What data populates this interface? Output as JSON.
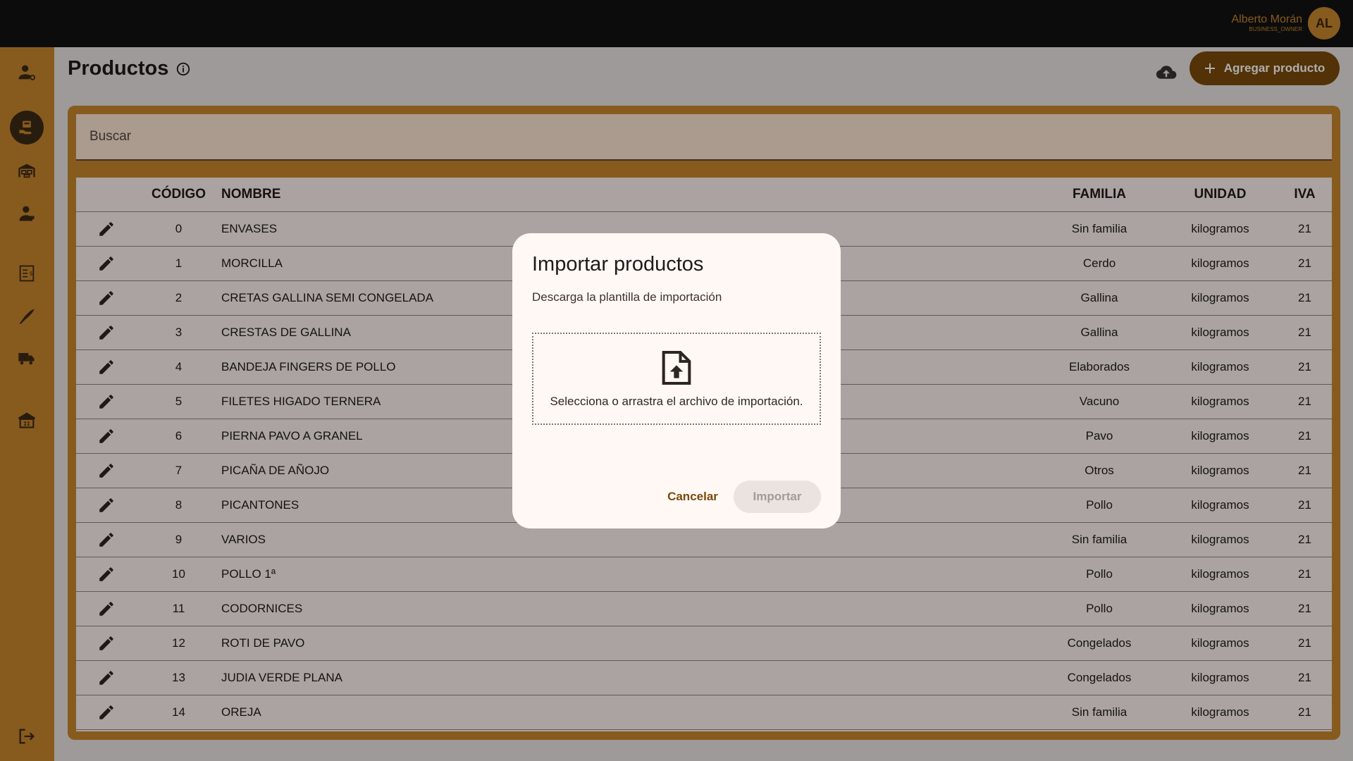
{
  "user": {
    "name": "Alberto Morán",
    "role": "BUSINESS_OWNER",
    "initials": "AL"
  },
  "sidebar": {
    "items": [
      {
        "icon": "user-settings-icon",
        "active": false
      },
      {
        "icon": "products-icon",
        "active": true
      },
      {
        "icon": "warehouse-icon",
        "active": false
      },
      {
        "icon": "customer-icon",
        "active": false
      },
      {
        "icon": "invoice-icon",
        "active": false
      },
      {
        "icon": "knife-icon",
        "active": false
      },
      {
        "icon": "truck-icon",
        "active": false
      },
      {
        "icon": "store-icon",
        "active": false
      },
      {
        "icon": "logout-icon",
        "active": false
      }
    ]
  },
  "page": {
    "title": "Productos",
    "add_label": "Agregar producto",
    "search_placeholder": "Buscar"
  },
  "table": {
    "headers": {
      "code": "CÓDIGO",
      "name": "NOMBRE",
      "family": "FAMILIA",
      "unit": "UNIDAD",
      "iva": "IVA"
    },
    "rows": [
      {
        "code": "0",
        "name": "ENVASES",
        "family": "Sin familia",
        "unit": "kilogramos",
        "iva": "21"
      },
      {
        "code": "1",
        "name": "MORCILLA",
        "family": "Cerdo",
        "unit": "kilogramos",
        "iva": "21"
      },
      {
        "code": "2",
        "name": "CRETAS GALLINA SEMI CONGELADA",
        "family": "Gallina",
        "unit": "kilogramos",
        "iva": "21"
      },
      {
        "code": "3",
        "name": "CRESTAS DE GALLINA",
        "family": "Gallina",
        "unit": "kilogramos",
        "iva": "21"
      },
      {
        "code": "4",
        "name": "BANDEJA FINGERS DE POLLO",
        "family": "Elaborados",
        "unit": "kilogramos",
        "iva": "21"
      },
      {
        "code": "5",
        "name": "FILETES HIGADO TERNERA",
        "family": "Vacuno",
        "unit": "kilogramos",
        "iva": "21"
      },
      {
        "code": "6",
        "name": "PIERNA PAVO A GRANEL",
        "family": "Pavo",
        "unit": "kilogramos",
        "iva": "21"
      },
      {
        "code": "7",
        "name": "PICAÑA DE AÑOJO",
        "family": "Otros",
        "unit": "kilogramos",
        "iva": "21"
      },
      {
        "code": "8",
        "name": "PICANTONES",
        "family": "Pollo",
        "unit": "kilogramos",
        "iva": "21"
      },
      {
        "code": "9",
        "name": "VARIOS",
        "family": "Sin familia",
        "unit": "kilogramos",
        "iva": "21"
      },
      {
        "code": "10",
        "name": "POLLO 1ª",
        "family": "Pollo",
        "unit": "kilogramos",
        "iva": "21"
      },
      {
        "code": "11",
        "name": "CODORNICES",
        "family": "Pollo",
        "unit": "kilogramos",
        "iva": "21"
      },
      {
        "code": "12",
        "name": "ROTI DE PAVO",
        "family": "Congelados",
        "unit": "kilogramos",
        "iva": "21"
      },
      {
        "code": "13",
        "name": "JUDIA VERDE PLANA",
        "family": "Congelados",
        "unit": "kilogramos",
        "iva": "21"
      },
      {
        "code": "14",
        "name": "OREJA",
        "family": "Sin familia",
        "unit": "kilogramos",
        "iva": "21"
      }
    ]
  },
  "modal": {
    "title": "Importar productos",
    "template_link": "Descarga la plantilla de importación",
    "drop_text": "Selecciona o arrastra el archivo de importación.",
    "cancel_label": "Cancelar",
    "import_label": "Importar"
  },
  "colors": {
    "accent": "#c8872d",
    "primary": "#7a4a0a",
    "topbar": "#121212"
  }
}
